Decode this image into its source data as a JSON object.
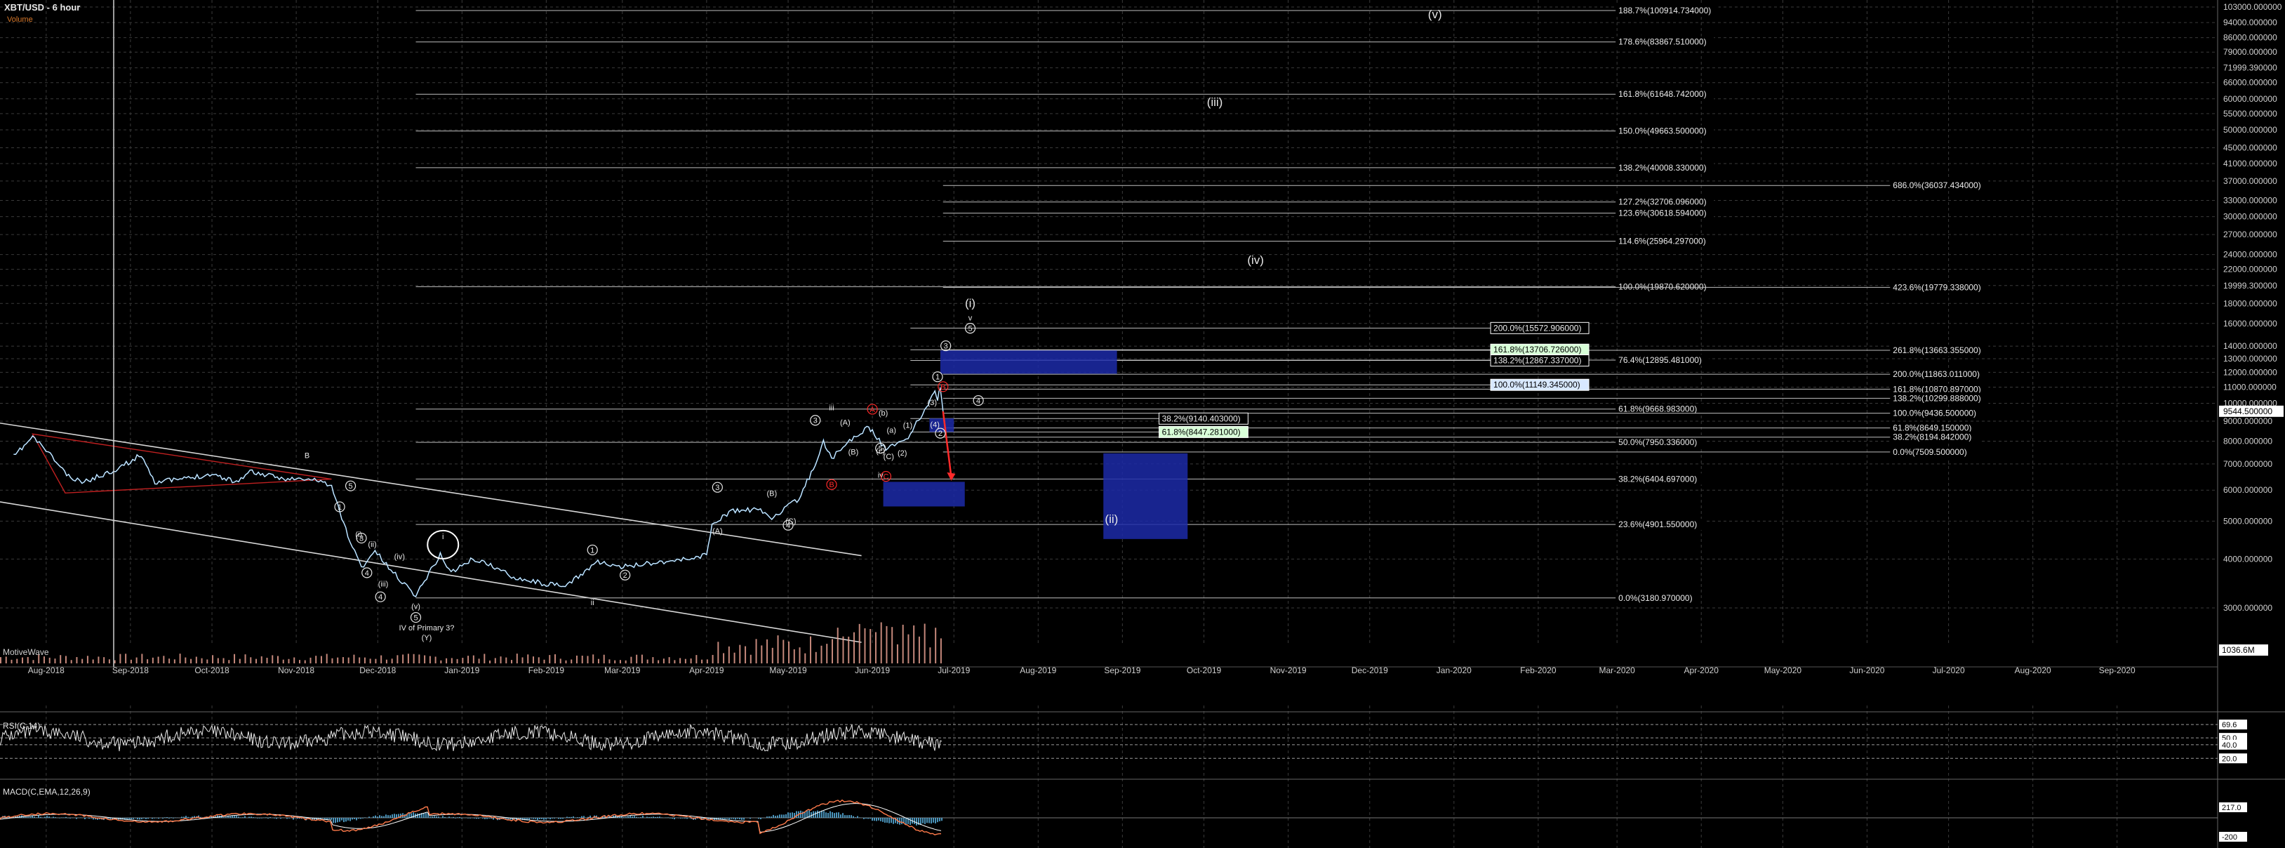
{
  "header": {
    "title": "XBT/USD - 6 hour",
    "volume_label": "Volume",
    "brand": "MotiveWave"
  },
  "indicators": {
    "rsi_label": "RSI(C,14)",
    "macd_label": "MACD(C,EMA,12,26,9)"
  },
  "colors": {
    "background": "#000000",
    "grid": "#3a3a3a",
    "price": "#ffffff",
    "up": "#4fa6e8",
    "channel": "#d7d7d7",
    "red": "#ff2a2a",
    "blue_box": "#1c2aa8",
    "volume": "#e8a090",
    "macd": "#ff7a4a",
    "signal": "#ffffff"
  },
  "chart_data": {
    "type": "line",
    "scale": "log",
    "ylim": [
      2400,
      103000
    ],
    "xlabel": "",
    "ylabel": "",
    "x_ticks": [
      "Aug-2018",
      "Sep-2018",
      "Oct-2018",
      "Nov-2018",
      "Dec-2018",
      "Jan-2019",
      "Feb-2019",
      "Mar-2019",
      "Apr-2019",
      "May-2019",
      "Jun-2019",
      "Jul-2019",
      "Aug-2019",
      "Sep-2019",
      "Oct-2019",
      "Nov-2019",
      "Dec-2019",
      "Jan-2020",
      "Feb-2020",
      "Mar-2020",
      "Apr-2020",
      "May-2020",
      "Jun-2020",
      "Jul-2020",
      "Aug-2020",
      "Sep-2020"
    ],
    "y_ticks": [
      {
        "v": 103000,
        "label": "103000.000000"
      },
      {
        "v": 94000,
        "label": "94000.000000"
      },
      {
        "v": 86000,
        "label": "86000.000000"
      },
      {
        "v": 79000,
        "label": "79000.000000"
      },
      {
        "v": 71999,
        "label": "71999.390000"
      },
      {
        "v": 66000,
        "label": "66000.000000"
      },
      {
        "v": 60000,
        "label": "60000.000000"
      },
      {
        "v": 55000,
        "label": "55000.000000"
      },
      {
        "v": 50000,
        "label": "50000.000000"
      },
      {
        "v": 45000,
        "label": "45000.000000"
      },
      {
        "v": 41000,
        "label": "41000.000000"
      },
      {
        "v": 37000,
        "label": "37000.000000"
      },
      {
        "v": 33000,
        "label": "33000.000000"
      },
      {
        "v": 30000,
        "label": "30000.000000"
      },
      {
        "v": 27000,
        "label": "27000.000000"
      },
      {
        "v": 24000,
        "label": "24000.000000"
      },
      {
        "v": 22000,
        "label": "22000.000000"
      },
      {
        "v": 19999,
        "label": "19999.300000"
      },
      {
        "v": 18000,
        "label": "18000.000000"
      },
      {
        "v": 16000,
        "label": "16000.000000"
      },
      {
        "v": 14000,
        "label": "14000.000000"
      },
      {
        "v": 13000,
        "label": "13000.000000"
      },
      {
        "v": 12000,
        "label": "12000.000000"
      },
      {
        "v": 11000,
        "label": "11000.000000"
      },
      {
        "v": 10000,
        "label": "10000.000000"
      },
      {
        "v": 9000,
        "label": "9000.000000"
      },
      {
        "v": 8000,
        "label": "8000.000000"
      },
      {
        "v": 7000,
        "label": "7000.000000"
      },
      {
        "v": 6000,
        "label": "6000.000000"
      },
      {
        "v": 5000,
        "label": "5000.000000"
      },
      {
        "v": 4000,
        "label": "4000.000000"
      },
      {
        "v": 3000,
        "label": "3000.000000"
      }
    ],
    "last_price": {
      "v": 9544.5,
      "label": "9544.500000"
    },
    "volume_readout": "1036.6M",
    "price_series": [
      [
        "2018-07-20",
        7300
      ],
      [
        "2018-07-27",
        8200
      ],
      [
        "2018-08-01",
        7600
      ],
      [
        "2018-08-10",
        6400
      ],
      [
        "2018-08-15",
        6300
      ],
      [
        "2018-08-25",
        6700
      ],
      [
        "2018-09-01",
        7100
      ],
      [
        "2018-09-05",
        7400
      ],
      [
        "2018-09-10",
        6300
      ],
      [
        "2018-09-20",
        6400
      ],
      [
        "2018-10-01",
        6600
      ],
      [
        "2018-10-10",
        6300
      ],
      [
        "2018-10-15",
        6700
      ],
      [
        "2018-10-25",
        6450
      ],
      [
        "2018-11-01",
        6400
      ],
      [
        "2018-11-10",
        6350
      ],
      [
        "2018-11-14",
        6100
      ],
      [
        "2018-11-20",
        4600
      ],
      [
        "2018-11-25",
        3800
      ],
      [
        "2018-11-30",
        4200
      ],
      [
        "2018-12-05",
        3800
      ],
      [
        "2018-12-10",
        3500
      ],
      [
        "2018-12-15",
        3230
      ],
      [
        "2018-12-19",
        3600
      ],
      [
        "2018-12-24",
        4100
      ],
      [
        "2018-12-28",
        3700
      ],
      [
        "2019-01-05",
        4000
      ],
      [
        "2019-01-10",
        3900
      ],
      [
        "2019-01-20",
        3600
      ],
      [
        "2019-02-01",
        3450
      ],
      [
        "2019-02-08",
        3400
      ],
      [
        "2019-02-20",
        3950
      ],
      [
        "2019-02-27",
        3800
      ],
      [
        "2019-03-10",
        3900
      ],
      [
        "2019-03-25",
        4000
      ],
      [
        "2019-04-01",
        4100
      ],
      [
        "2019-04-03",
        4900
      ],
      [
        "2019-04-10",
        5300
      ],
      [
        "2019-04-20",
        5350
      ],
      [
        "2019-04-25",
        5100
      ],
      [
        "2019-05-05",
        5700
      ],
      [
        "2019-05-11",
        7000
      ],
      [
        "2019-05-14",
        8000
      ],
      [
        "2019-05-17",
        7200
      ],
      [
        "2019-05-22",
        7900
      ],
      [
        "2019-05-26",
        8200
      ],
      [
        "2019-05-30",
        8700
      ],
      [
        "2019-06-01",
        8500
      ],
      [
        "2019-06-06",
        7600
      ],
      [
        "2019-06-10",
        7900
      ],
      [
        "2019-06-15",
        8300
      ],
      [
        "2019-06-18",
        9100
      ],
      [
        "2019-06-21",
        9700
      ],
      [
        "2019-06-23",
        10500
      ],
      [
        "2019-06-24",
        10800
      ],
      [
        "2019-06-25",
        10300
      ],
      [
        "2019-06-26",
        10900
      ],
      [
        "2019-06-27",
        9544
      ]
    ],
    "fib_levels": [
      {
        "label": "188.7%(100914.734000)",
        "v": 100914.734,
        "from": "2018-12-15",
        "to": "2020-03-01"
      },
      {
        "label": "178.6%(83867.510000)",
        "v": 83867.51,
        "from": "2018-12-15",
        "to": "2020-03-01"
      },
      {
        "label": "161.8%(61648.742000)",
        "v": 61648.742,
        "from": "2018-12-15",
        "to": "2020-03-01"
      },
      {
        "label": "150.0%(49663.500000)",
        "v": 49663.5,
        "from": "2018-12-15",
        "to": "2020-03-01"
      },
      {
        "label": "138.2%(40008.330000)",
        "v": 40008.33,
        "from": "2018-12-15",
        "to": "2020-03-01"
      },
      {
        "label": "127.2%(32706.096000)",
        "v": 32706.096,
        "from": "2019-06-27",
        "to": "2020-03-01"
      },
      {
        "label": "123.6%(30618.594000)",
        "v": 30618.594,
        "from": "2019-06-27",
        "to": "2020-03-01"
      },
      {
        "label": "114.6%(25964.297000)",
        "v": 25964.297,
        "from": "2019-06-27",
        "to": "2020-03-01"
      },
      {
        "label": "100.0%(19870.620000)",
        "v": 19870.62,
        "from": "2018-12-15",
        "to": "2020-03-01"
      },
      {
        "label": "76.4%(12895.481000)",
        "v": 12895.481,
        "from": "2019-06-27",
        "to": "2020-03-01"
      },
      {
        "label": "61.8%(9668.983000)",
        "v": 9668.983,
        "from": "2018-12-15",
        "to": "2020-03-01"
      },
      {
        "label": "50.0%(7950.336000)",
        "v": 7950.336,
        "from": "2018-12-15",
        "to": "2020-03-01"
      },
      {
        "label": "38.2%(6404.697000)",
        "v": 6404.697,
        "from": "2018-12-15",
        "to": "2020-03-01"
      },
      {
        "label": "23.6%(4901.550000)",
        "v": 4901.55,
        "from": "2018-12-15",
        "to": "2020-03-01"
      },
      {
        "label": "0.0%(3180.970000)",
        "v": 3180.97,
        "from": "2018-12-15",
        "to": "2020-03-01"
      },
      {
        "label": "686.0%(36037.434000)",
        "v": 36037.434,
        "from": "2019-06-27",
        "to": "2020-06-10"
      },
      {
        "label": "423.6%(19779.338000)",
        "v": 19779.338,
        "from": "2019-06-27",
        "to": "2020-06-10"
      },
      {
        "label": "261.8%(13663.355000)",
        "v": 13663.355,
        "from": "2019-06-27",
        "to": "2020-06-10"
      },
      {
        "label": "200.0%(11863.011000)",
        "v": 11863.011,
        "from": "2019-06-27",
        "to": "2020-06-10"
      },
      {
        "label": "161.8%(10870.897000)",
        "v": 10870.897,
        "from": "2019-06-27",
        "to": "2020-06-10"
      },
      {
        "label": "138.2%(10299.888000)",
        "v": 10299.888,
        "from": "2019-06-27",
        "to": "2020-06-10"
      },
      {
        "label": "100.0%(9436.500000)",
        "v": 9436.5,
        "from": "2019-06-27",
        "to": "2020-06-10"
      },
      {
        "label": "61.8%(8649.150000)",
        "v": 8649.15,
        "from": "2019-06-27",
        "to": "2020-06-10"
      },
      {
        "label": "38.2%(8194.842000)",
        "v": 8194.842,
        "from": "2019-06-27",
        "to": "2020-06-10"
      },
      {
        "label": "0.0%(7509.500000)",
        "v": 7509.5,
        "from": "2019-06-27",
        "to": "2020-06-10"
      },
      {
        "label": "200.0%(15572.906000)",
        "v": 15572.906,
        "from": "2019-06-15",
        "to": "2020-01-15",
        "boxed": true
      },
      {
        "label": "161.8%(13706.726000)",
        "v": 13706.726,
        "from": "2019-06-15",
        "to": "2020-01-15",
        "boxed": true,
        "color": "#d8ffd8"
      },
      {
        "label": "138.2%(12867.337000)",
        "v": 12867.337,
        "from": "2019-06-15",
        "to": "2020-01-15",
        "boxed": true
      },
      {
        "label": "100.0%(11149.345000)",
        "v": 11149.345,
        "from": "2019-06-15",
        "to": "2020-01-15",
        "boxed": true,
        "color": "#d8e8ff"
      },
      {
        "label": "38.2%(9140.403000)",
        "v": 9140.403,
        "from": "2019-06-15",
        "to": "2019-09-15",
        "boxed": true
      },
      {
        "label": "61.8%(8447.281000)",
        "v": 8447.281,
        "from": "2019-06-15",
        "to": "2019-09-15",
        "boxed": true,
        "color": "#d8ffd8"
      }
    ],
    "boxes": [
      {
        "from": "2019-06-26",
        "to": "2019-08-30",
        "lo": 11900,
        "hi": 13650
      },
      {
        "from": "2019-06-22",
        "to": "2019-07-01",
        "lo": 8450,
        "hi": 9150
      },
      {
        "from": "2019-06-05",
        "to": "2019-07-05",
        "lo": 5450,
        "hi": 6300
      },
      {
        "from": "2019-08-25",
        "to": "2019-09-25",
        "lo": 4500,
        "hi": 7450
      }
    ],
    "wave_labels": [
      {
        "t": "B",
        "d": "2018-11-05",
        "v": 7250
      },
      {
        "t": "(v)",
        "d": "2019-12-25",
        "v": 96500,
        "big": true
      },
      {
        "t": "(iii)",
        "d": "2019-10-05",
        "v": 57500,
        "big": true
      },
      {
        "t": "(iv)",
        "d": "2019-10-20",
        "v": 22700,
        "big": true
      },
      {
        "t": "(ii)",
        "d": "2019-08-28",
        "v": 4950,
        "big": true
      },
      {
        "t": "(i)",
        "d": "2019-07-07",
        "v": 17600,
        "big": true
      },
      {
        "t": "v",
        "d": "2019-07-07",
        "v": 16300
      },
      {
        "t": "5",
        "d": "2019-07-07",
        "v": 15300,
        "circ": true
      },
      {
        "t": "3",
        "d": "2019-06-28",
        "v": 13800,
        "circ": true
      },
      {
        "t": "4",
        "d": "2019-07-10",
        "v": 10000,
        "circ": true
      },
      {
        "t": "1",
        "d": "2019-06-25",
        "v": 11500,
        "circ": true
      },
      {
        "t": "2",
        "d": "2019-06-26",
        "v": 8250,
        "circ": true
      },
      {
        "t": "(3)",
        "d": "2019-06-23",
        "v": 9900
      },
      {
        "t": "(4)",
        "d": "2019-06-24",
        "v": 8700
      },
      {
        "t": "iii",
        "d": "2019-05-17",
        "v": 9600
      },
      {
        "t": "iv",
        "d": "2019-06-04",
        "v": 6450
      },
      {
        "t": "ii",
        "d": "2019-02-18",
        "v": 3050
      },
      {
        "t": "i",
        "d": "2018-12-25",
        "v": 4500,
        "oval": true
      },
      {
        "t": "IV of Primary 3?",
        "d": "2018-12-19",
        "v": 2630
      },
      {
        "t": "(Y)",
        "d": "2018-12-19",
        "v": 2480
      },
      {
        "t": "(A)",
        "d": "2019-04-05",
        "v": 4650
      },
      {
        "t": "(B)",
        "d": "2019-04-25",
        "v": 5800
      },
      {
        "t": "(C)",
        "d": "2019-05-02",
        "v": 4920
      },
      {
        "t": "(A)",
        "d": "2019-05-22",
        "v": 8800
      },
      {
        "t": "(B)",
        "d": "2019-05-25",
        "v": 7400
      },
      {
        "t": "(C)",
        "d": "2019-06-07",
        "v": 7200
      },
      {
        "t": "(1)",
        "d": "2019-06-14",
        "v": 8650
      },
      {
        "t": "(2)",
        "d": "2019-06-12",
        "v": 7350
      },
      {
        "t": "(a)",
        "d": "2019-06-08",
        "v": 8400
      },
      {
        "t": "(b)",
        "d": "2019-06-05",
        "v": 9300
      },
      {
        "t": "(c)",
        "d": "2019-06-04",
        "v": 7450
      },
      {
        "t": "(iii)",
        "d": "2018-12-03",
        "v": 3400
      },
      {
        "t": "(iv)",
        "d": "2018-12-09",
        "v": 4000
      },
      {
        "t": "(v)",
        "d": "2018-12-15",
        "v": 2980
      },
      {
        "t": "(ii)",
        "d": "2018-11-29",
        "v": 4300
      },
      {
        "t": "(i)",
        "d": "2018-11-24",
        "v": 4550
      },
      {
        "t": "3",
        "d": "2019-04-05",
        "v": 6000,
        "circ": true
      },
      {
        "t": "4",
        "d": "2019-05-01",
        "v": 4800,
        "circ": true
      },
      {
        "t": "1",
        "d": "2019-02-18",
        "v": 4150,
        "circ": true
      },
      {
        "t": "2",
        "d": "2019-03-02",
        "v": 3580,
        "circ": true
      },
      {
        "t": "1",
        "d": "2018-11-17",
        "v": 5350,
        "circ": true
      },
      {
        "t": "3",
        "d": "2018-11-25",
        "v": 4450,
        "circ": true
      },
      {
        "t": "4",
        "d": "2018-11-27",
        "v": 3630,
        "circ": true
      },
      {
        "t": "5",
        "d": "2018-12-15",
        "v": 2790,
        "circ": true
      },
      {
        "t": "3",
        "d": "2019-05-11",
        "v": 8900,
        "circ": true
      },
      {
        "t": "5",
        "d": "2019-06-04",
        "v": 7550,
        "circ": true
      },
      {
        "t": "4",
        "d": "2018-12-02",
        "v": 3150,
        "circ": true
      },
      {
        "t": "5",
        "d": "2018-11-21",
        "v": 6050,
        "circ": true
      },
      {
        "t": "A",
        "d": "2019-06-01",
        "v": 9500,
        "circ": true,
        "red": true
      },
      {
        "t": "C",
        "d": "2019-06-06",
        "v": 6400,
        "circ": true,
        "red": true
      },
      {
        "t": "B",
        "d": "2019-05-17",
        "v": 6100,
        "circ": true,
        "red": true
      },
      {
        "t": "B",
        "d": "2019-06-27",
        "v": 10850,
        "circ": true,
        "red": true
      }
    ],
    "rsi": {
      "label": "RSI(C,14)",
      "levels": [
        {
          "v": 69.6,
          "label": "69.6"
        },
        {
          "v": 50,
          "label": "50.0"
        },
        {
          "v": 40,
          "label": "40.0"
        },
        {
          "v": 20,
          "label": "20.0"
        }
      ]
    },
    "macd": {
      "label": "MACD(C,EMA,12,26,9)",
      "levels": [
        {
          "v": 217,
          "label": "217.0"
        },
        {
          "v": -200,
          "label": "-200"
        }
      ]
    }
  }
}
